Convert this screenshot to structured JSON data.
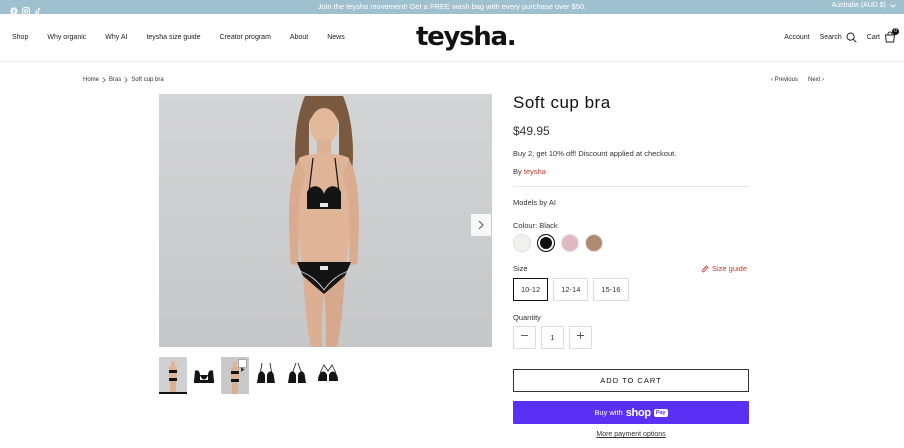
{
  "announcement": {
    "message": "Join the teysha movement! Get a FREE wash bag with every purchase over $50.",
    "region": "Australia (AUD $)",
    "social_icons": [
      "facebook-icon",
      "instagram-icon",
      "tiktok-icon"
    ]
  },
  "header": {
    "logo": "teysha.",
    "nav": [
      "Shop",
      "Why organic",
      "Why AI",
      "teysha size guide",
      "Creator program",
      "About",
      "News"
    ],
    "account_label": "Account",
    "search_label": "Search",
    "cart_label": "Cart",
    "cart_count": "0"
  },
  "breadcrumb": {
    "items": [
      "Home",
      "Bras",
      "Soft cup bra"
    ],
    "previous": "Previous",
    "next": "Next"
  },
  "gallery": {
    "thumbnail_count": 6,
    "active_thumbnail": 0,
    "video_thumbnail": 2
  },
  "product": {
    "title": "Soft cup bra",
    "price": "$49.95",
    "promo": "Buy 2, get 10% off! Discount applied at checkout.",
    "by_prefix": "By",
    "brand": "teysha",
    "models_note": "Models by AI",
    "colour_label": "Colour:",
    "colour_value": "Black",
    "swatches": [
      {
        "name": "White",
        "color": "#f2f1ee"
      },
      {
        "name": "Black",
        "color": "#111111"
      },
      {
        "name": "Pink",
        "color": "#e2b9c0"
      },
      {
        "name": "Tan",
        "color": "#b08a6e"
      }
    ],
    "selected_swatch": 1,
    "size_label": "Size",
    "size_guide_label": "Size guide",
    "sizes": [
      "10-12",
      "12-14",
      "15-16"
    ],
    "selected_size": 0,
    "quantity_label": "Quantity",
    "quantity": "1",
    "add_to_cart": "ADD TO CART",
    "buy_with": "Buy with",
    "shop_brand": "shop",
    "pay_badge": "Pay",
    "more_payment": "More payment options"
  },
  "colors": {
    "announcement_bg": "#9fc1cf",
    "accent_red": "#c0392b",
    "shop_pay": "#5a31f4"
  }
}
